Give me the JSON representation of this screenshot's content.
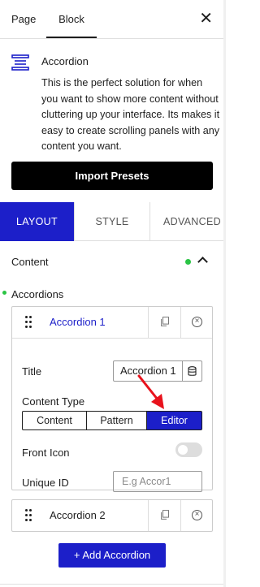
{
  "header": {
    "tabs": [
      "Page",
      "Block"
    ],
    "active_tab": "Block",
    "close_icon": "close-icon"
  },
  "block": {
    "title": "Accordion",
    "description": "This is the perfect solution for when you want to show more content without cluttering up your interface. Its makes it easy to create scrolling panels with any content you want.",
    "import_label": "Import Presets"
  },
  "section_tabs": [
    "LAYOUT",
    "STYLE",
    "ADVANCED"
  ],
  "content": {
    "heading": "Content",
    "accordions_label": "Accordions"
  },
  "accordions": [
    {
      "name": "Accordion 1",
      "expanded": true,
      "title_label": "Title",
      "title_value": "Accordion 1",
      "content_type_label": "Content Type",
      "content_type_options": [
        "Content",
        "Pattern",
        "Editor"
      ],
      "content_type_selected": "Editor",
      "front_icon_label": "Front Icon",
      "front_icon_enabled": false,
      "unique_id_label": "Unique ID",
      "unique_id_placeholder": "E.g Accor1"
    },
    {
      "name": "Accordion 2",
      "expanded": false
    }
  ],
  "add_label": "+ Add Accordion",
  "colors": {
    "accent": "#1c1fc9",
    "status_green": "#2ac444",
    "annotation_arrow": "#e8121c"
  }
}
